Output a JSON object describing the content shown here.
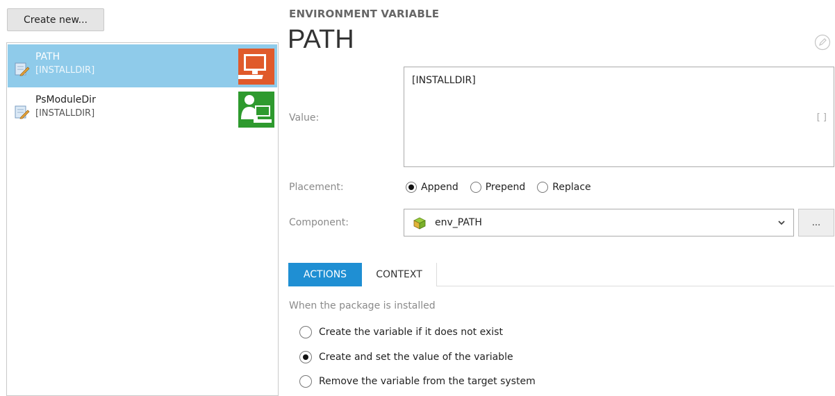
{
  "toolbar": {
    "create_label": "Create new..."
  },
  "list": {
    "items": [
      {
        "name": "PATH",
        "sub": "[INSTALLDIR]",
        "badge": "computer-badge-icon",
        "badge_color": "#e05a2b",
        "selected": true
      },
      {
        "name": "PsModuleDir",
        "sub": "[INSTALLDIR]",
        "badge": "user-computer-badge-icon",
        "badge_color": "#2e9a2e",
        "selected": false
      }
    ]
  },
  "header": {
    "eyebrow": "ENVIRONMENT VARIABLE",
    "title": "PATH"
  },
  "form": {
    "value_label": "Value:",
    "value_text": "[INSTALLDIR]",
    "expand_label": "[ ]",
    "placement_label": "Placement:",
    "placement_options": [
      {
        "label": "Append",
        "checked": true
      },
      {
        "label": "Prepend",
        "checked": false
      },
      {
        "label": "Replace",
        "checked": false
      }
    ],
    "component_label": "Component:",
    "component_value": "env_PATH",
    "browse_label": "..."
  },
  "tabs": [
    {
      "label": "ACTIONS",
      "active": true
    },
    {
      "label": "CONTEXT",
      "active": false
    }
  ],
  "actions": {
    "section_label": "When the package is installed",
    "options": [
      {
        "label": "Create the variable if it does not exist",
        "checked": false
      },
      {
        "label": "Create and set the value of the variable",
        "checked": true
      },
      {
        "label": "Remove the variable from the target system",
        "checked": false
      }
    ]
  },
  "colors": {
    "accent": "#1f8fd3",
    "selection": "#8fcbea"
  }
}
